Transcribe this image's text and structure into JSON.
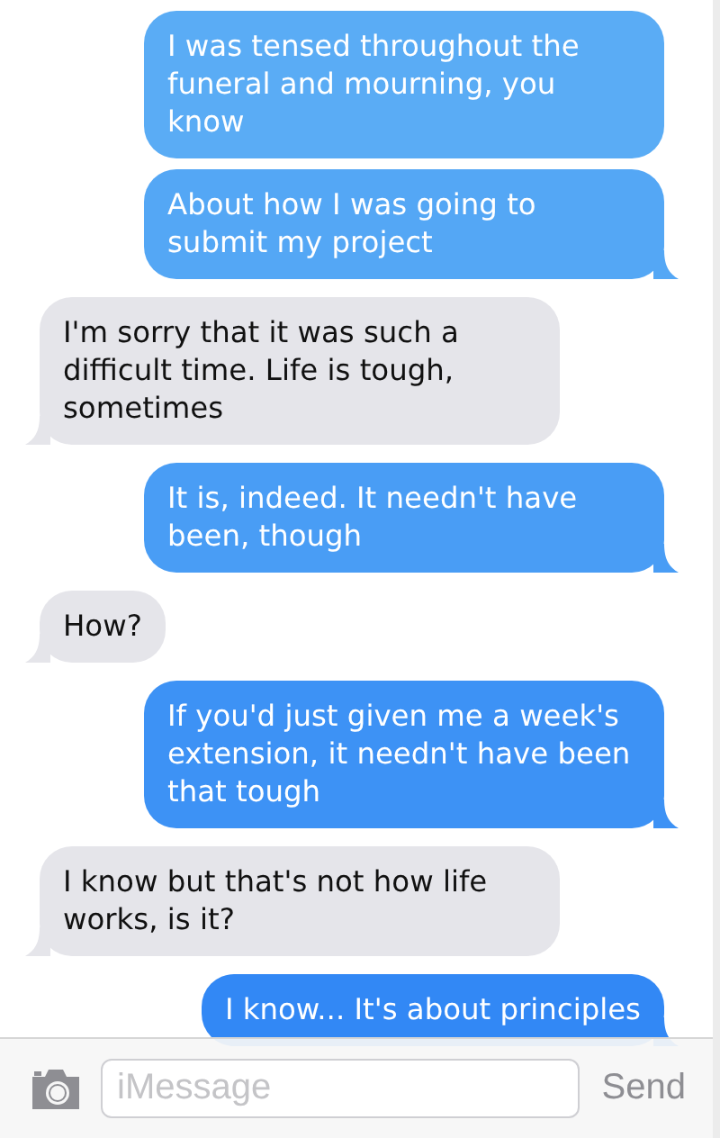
{
  "messages": [
    {
      "kind": "sent",
      "text": "I was tensed throughout the funeral and mourning, you know"
    },
    {
      "kind": "sent",
      "text": "About how I was going to submit my project"
    },
    {
      "kind": "received",
      "text": "I'm sorry that it was such a difficult time. Life is tough, sometimes"
    },
    {
      "kind": "sent",
      "text": "It is, indeed. It needn't have been, though"
    },
    {
      "kind": "received",
      "text": "How?"
    },
    {
      "kind": "sent",
      "text": "If you'd just given me a week's extension, it needn't have been that tough"
    },
    {
      "kind": "received",
      "text": "I know but that's not how life works, is it?"
    },
    {
      "kind": "sent",
      "text": "I know... It's about principles"
    }
  ],
  "composer": {
    "placeholder": "iMessage",
    "send_label": "Send"
  }
}
